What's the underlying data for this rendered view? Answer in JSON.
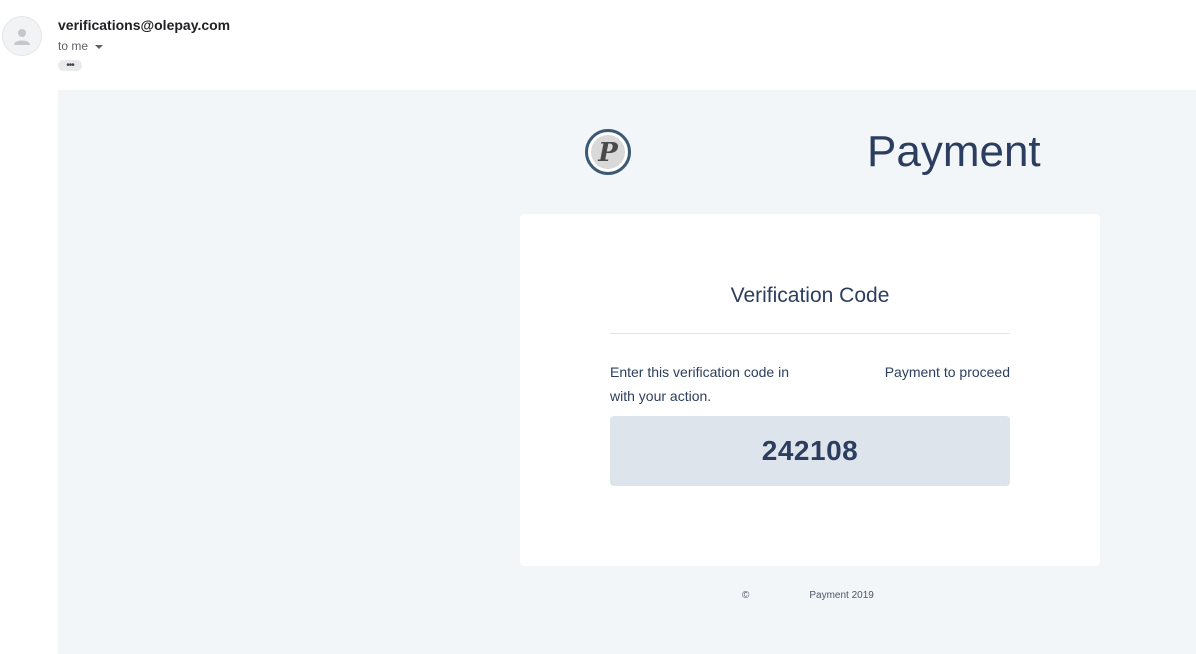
{
  "email": {
    "sender": "verifications@olepay.com",
    "recipient": "to me",
    "more_label": "•••"
  },
  "brand": {
    "logo_letter": "P",
    "title": "Payment"
  },
  "card": {
    "title": "Verification Code",
    "instruction_part1": "Enter this verification code in",
    "instruction_part2": "Payment to proceed",
    "instruction_part3": "with your action.",
    "code": "242108"
  },
  "footer": {
    "copyright_symbol": "©",
    "text": "Payment 2019"
  },
  "colors": {
    "brand_navy": "#2c3e5f",
    "body_background": "#f3f6f9",
    "code_background": "#dee4eb"
  },
  "icons": {
    "avatar": "person-icon",
    "expand": "caret-down-icon",
    "logo": "p-logo-icon"
  }
}
